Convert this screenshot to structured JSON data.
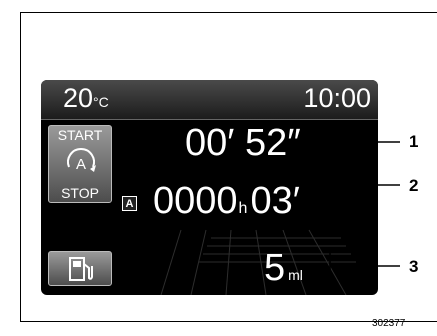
{
  "display": {
    "temperature": {
      "value": "20",
      "unit": "°C"
    },
    "clock": "10:00",
    "start_stop_button": {
      "start_label": "START",
      "center_label": "A",
      "stop_label": "STOP"
    },
    "auto_badge": "A",
    "time_counter": "00′ 52″",
    "accumulated_time": {
      "hours": "0000",
      "hours_unit": "h",
      "minutes": "03′"
    },
    "fuel_saved": {
      "value": "5",
      "unit": "ml"
    }
  },
  "callouts": [
    "1",
    "2",
    "3"
  ],
  "image_code": "302377",
  "colors": {
    "display_bg": "#000000",
    "text": "#ffffff",
    "button_gray": "#7a7a7a"
  },
  "icons": [
    "start-stop-a-icon",
    "fuel-pump-icon"
  ]
}
